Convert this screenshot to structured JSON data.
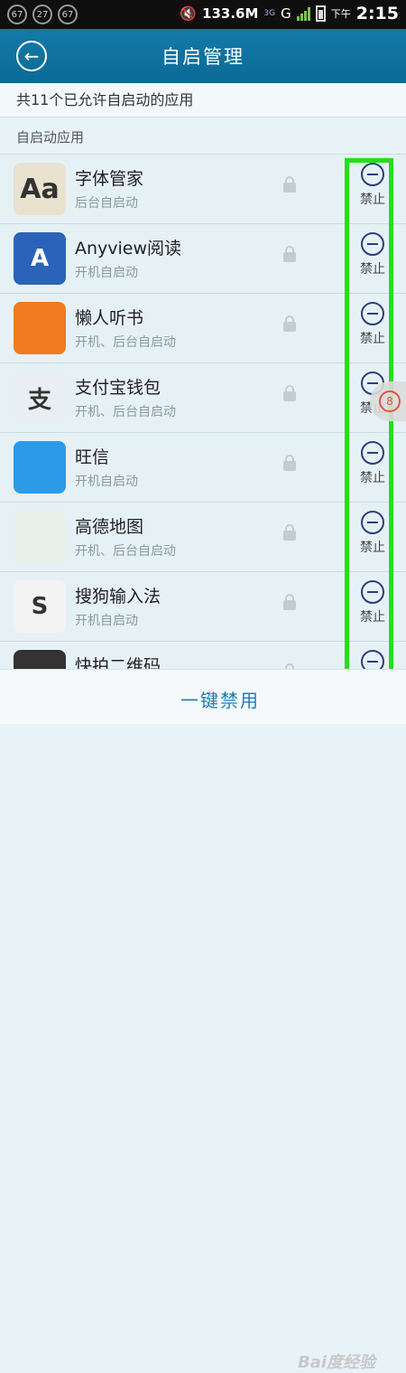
{
  "status_bar": {
    "notif_icons": [
      "67",
      "27",
      "67"
    ],
    "speed": "133.6M",
    "network": "3G",
    "signal_label": "G",
    "ampm": "下午",
    "time": "2:15"
  },
  "header": {
    "title": "自启管理"
  },
  "summary": "共11个已允许自启动的应用",
  "section_label": "自启动应用",
  "disable_label": "禁止",
  "apps": [
    {
      "name": "字体管家",
      "sub": "后台自启动",
      "icon": "font-manager-icon",
      "icon_text": "Aa",
      "color": "#e9e2cf"
    },
    {
      "name": "Anyview阅读",
      "sub": "开机自启动",
      "icon": "anyview-book-icon",
      "icon_text": "A",
      "color": "#2a63b8"
    },
    {
      "name": "懒人听书",
      "sub": "开机、后台自启动",
      "icon": "headphones-icon",
      "icon_text": "",
      "color": "#f07a1f"
    },
    {
      "name": "支付宝钱包",
      "sub": "开机、后台自启动",
      "icon": "alipay-icon",
      "icon_text": "支",
      "color": "#e9eef2"
    },
    {
      "name": "旺信",
      "sub": "开机自启动",
      "icon": "wangxin-chat-icon",
      "icon_text": "",
      "color": "#2b9be8"
    },
    {
      "name": "高德地图",
      "sub": "开机、后台自启动",
      "icon": "amap-plane-icon",
      "icon_text": "",
      "color": "#e8f0ea"
    },
    {
      "name": "搜狗输入法",
      "sub": "开机自启动",
      "icon": "sogou-input-icon",
      "icon_text": "S",
      "color": "#f4f4f4"
    },
    {
      "name": "快拍二维码",
      "sub": "",
      "icon": "qrcode-camera-icon",
      "icon_text": "",
      "color": "#333333"
    }
  ],
  "bottom": {
    "button_label": "一键禁用",
    "watermark": "Bai度经验"
  }
}
